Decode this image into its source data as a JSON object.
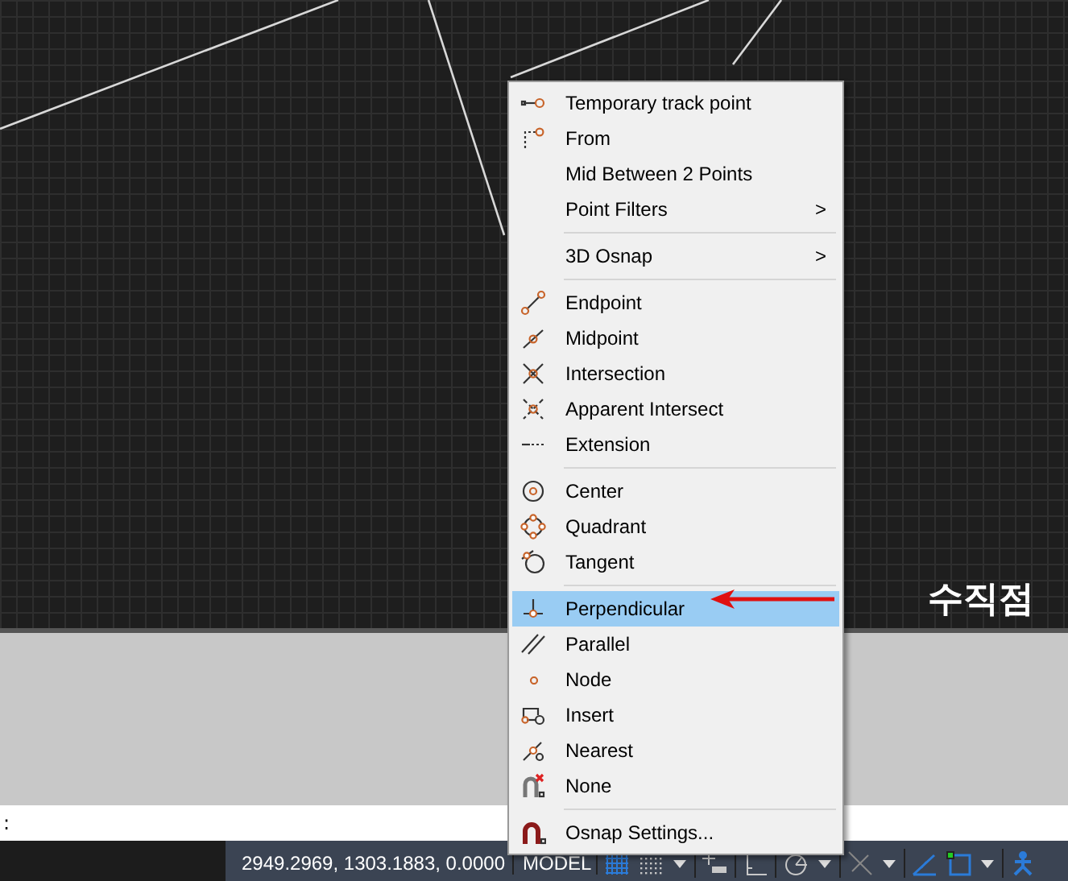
{
  "command_line": {
    "prompt": ":"
  },
  "status_bar": {
    "coordinates": "2949.2969, 1303.1883, 0.0000",
    "model_button": "MODEL",
    "tools": [
      {
        "kind": "grid",
        "on": true
      },
      {
        "kind": "snap",
        "on": false
      },
      {
        "kind": "caret"
      },
      {
        "kind": "ortho",
        "on": false
      },
      {
        "kind": "angle",
        "on": false
      },
      {
        "kind": "polar",
        "on": false
      },
      {
        "kind": "caret"
      },
      {
        "kind": "iso",
        "on": false
      },
      {
        "kind": "caret"
      },
      {
        "kind": "track",
        "on": true
      },
      {
        "kind": "osnap",
        "on": true
      },
      {
        "kind": "caret"
      },
      {
        "kind": "figure",
        "on": true
      }
    ]
  },
  "annotation": {
    "label": "수직점"
  },
  "context_menu": {
    "groups": [
      [
        {
          "label": "Temporary track point",
          "kind": "track",
          "selected": false
        },
        {
          "label": "From",
          "kind": "from",
          "selected": false
        },
        {
          "label": "Mid Between 2 Points",
          "kind": "plain",
          "selected": false
        },
        {
          "label": "Point Filters",
          "kind": "plain",
          "submenu": ">",
          "selected": false
        }
      ],
      [
        {
          "label": "3D Osnap",
          "kind": "plain",
          "submenu": ">",
          "selected": false
        }
      ],
      [
        {
          "label": "Endpoint",
          "kind": "endpoint",
          "selected": false
        },
        {
          "label": "Midpoint",
          "kind": "midpoint",
          "selected": false
        },
        {
          "label": "Intersection",
          "kind": "intersection",
          "selected": false
        },
        {
          "label": "Apparent Intersect",
          "kind": "apparent",
          "selected": false
        },
        {
          "label": "Extension",
          "kind": "extension",
          "selected": false
        }
      ],
      [
        {
          "label": "Center",
          "kind": "center",
          "selected": false
        },
        {
          "label": "Quadrant",
          "kind": "quadrant",
          "selected": false
        },
        {
          "label": "Tangent",
          "kind": "tangent",
          "selected": false
        }
      ],
      [
        {
          "label": "Perpendicular",
          "kind": "perpendicular",
          "selected": true
        },
        {
          "label": "Parallel",
          "kind": "parallel",
          "selected": false
        },
        {
          "label": "Node",
          "kind": "node",
          "selected": false
        },
        {
          "label": "Insert",
          "kind": "insert",
          "selected": false
        },
        {
          "label": "Nearest",
          "kind": "nearest",
          "selected": false
        },
        {
          "label": "None",
          "kind": "nosnap",
          "selected": false
        }
      ],
      [
        {
          "label": "Osnap Settings...",
          "kind": "magnet",
          "selected": false
        }
      ]
    ]
  }
}
